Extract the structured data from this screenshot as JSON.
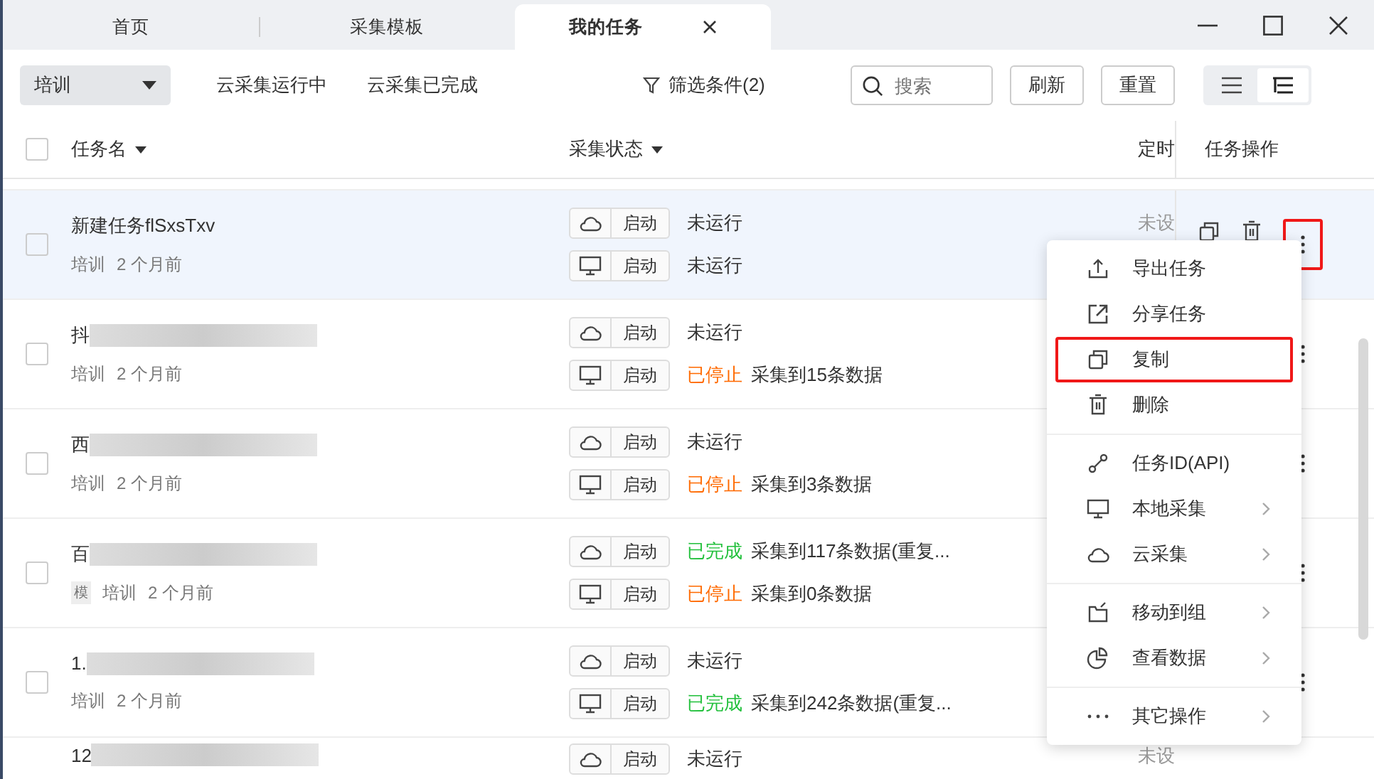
{
  "tabs": [
    {
      "label": "首页",
      "selected": false
    },
    {
      "label": "采集模板",
      "selected": false
    },
    {
      "label": "我的任务",
      "selected": true
    }
  ],
  "toolbar": {
    "group_select": "培训",
    "filters": [
      "云采集运行中",
      "云采集已完成"
    ],
    "filter_conditions": "筛选条件(2)",
    "search": {
      "placeholder": "搜索"
    },
    "buttons": [
      "刷新",
      "重置"
    ],
    "view_modes": [
      {
        "kind": "list",
        "selected": false
      },
      {
        "kind": "tree",
        "selected": true
      }
    ]
  },
  "select_all": {
    "checked": false
  },
  "columns": [
    {
      "label": "任务名",
      "sortable": true
    },
    {
      "label": "采集状态",
      "sortable": true
    },
    {
      "label": "定时",
      "sortable": false
    },
    {
      "label": "任务操作",
      "sortable": false
    }
  ],
  "rows": [
    {
      "name": "新建任务flSxsTxv",
      "checked": false,
      "redacted": false,
      "highlighted": true,
      "group": "培训",
      "time": "2 个月前",
      "schedule": "未设",
      "runs": [
        {
          "kind": "cloud",
          "button": "启动",
          "status": "未运行",
          "color": "#333333"
        },
        {
          "kind": "local",
          "button": "启动",
          "status": "未运行",
          "color": "#333333"
        }
      ]
    },
    {
      "name": "抖",
      "checked": false,
      "redacted": true,
      "highlighted": false,
      "group": "培训",
      "time": "2 个月前",
      "runs": [
        {
          "kind": "cloud",
          "button": "启动",
          "status": "未运行",
          "color": "#333333"
        },
        {
          "kind": "local",
          "button": "启动",
          "status": "已停止",
          "color": "#ff6a00",
          "detail": "采集到15条数据"
        }
      ]
    },
    {
      "name": "西",
      "checked": false,
      "redacted": true,
      "highlighted": false,
      "group": "培训",
      "time": "2 个月前",
      "runs": [
        {
          "kind": "cloud",
          "button": "启动",
          "status": "未运行",
          "color": "#333333"
        },
        {
          "kind": "local",
          "button": "启动",
          "status": "已停止",
          "color": "#ff6a00",
          "detail": "采集到3条数据"
        }
      ]
    },
    {
      "name": "百",
      "checked": false,
      "redacted": true,
      "highlighted": false,
      "badge": "模",
      "group": "培训",
      "time": "2 个月前",
      "runs": [
        {
          "kind": "cloud",
          "button": "启动",
          "status": "已完成",
          "color": "#22c03c",
          "detail": "采集到117条数据(重复..."
        },
        {
          "kind": "local",
          "button": "启动",
          "status": "已停止",
          "color": "#ff6a00",
          "detail": "采集到0条数据"
        }
      ]
    },
    {
      "name": "1.",
      "checked": false,
      "redacted": true,
      "highlighted": false,
      "group": "培训",
      "time": "2 个月前",
      "runs": [
        {
          "kind": "cloud",
          "button": "启动",
          "status": "未运行",
          "color": "#333333"
        },
        {
          "kind": "local",
          "button": "启动",
          "status": "已完成",
          "color": "#22c03c",
          "detail": "采集到242条数据(重复..."
        }
      ]
    },
    {
      "name": "12",
      "redacted": true,
      "highlighted": false,
      "schedule": "未设",
      "runs": [
        {
          "kind": "cloud",
          "button": "启动",
          "status": "未运行",
          "color": "#333333"
        }
      ]
    }
  ],
  "context_menu": {
    "groups": [
      [
        {
          "kind": "upload",
          "label": "导出任务",
          "submenu": false,
          "highlighted": false
        },
        {
          "kind": "share",
          "label": "分享任务",
          "submenu": false,
          "highlighted": false
        },
        {
          "kind": "copy",
          "label": "复制",
          "submenu": false,
          "highlighted": true
        },
        {
          "kind": "trash",
          "label": "删除",
          "submenu": false,
          "highlighted": false
        }
      ],
      [
        {
          "kind": "link",
          "label": "任务ID(API)",
          "submenu": false,
          "highlighted": false
        },
        {
          "kind": "monitor",
          "label": "本地采集",
          "submenu": true,
          "highlighted": false
        },
        {
          "kind": "cloud",
          "label": "云采集",
          "submenu": true,
          "highlighted": false
        }
      ],
      [
        {
          "kind": "folder",
          "label": "移动到组",
          "submenu": true,
          "highlighted": false
        },
        {
          "kind": "pie",
          "label": "查看数据",
          "submenu": true,
          "highlighted": false
        }
      ],
      [
        {
          "kind": "dots",
          "label": "其它操作",
          "submenu": true,
          "highlighted": false
        }
      ]
    ]
  }
}
